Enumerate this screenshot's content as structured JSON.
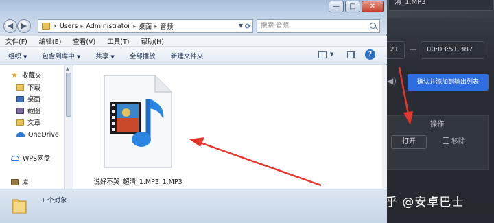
{
  "background_app": {
    "filename": "清_1.MP3",
    "time_start": "21",
    "time_end": "00:03:51.387",
    "confirm_button": "确认并添加到输出列表",
    "operations_header": "操作",
    "open_button": "打开",
    "remove_button": "移除"
  },
  "explorer": {
    "window_controls": {
      "minimize": "—",
      "maximize": "□",
      "close": "✕"
    },
    "breadcrumb": [
      "«",
      "Users",
      "Administrator",
      "桌面",
      "音频"
    ],
    "search_placeholder": "搜索 音频",
    "menu": [
      "文件(F)",
      "编辑(E)",
      "查看(V)",
      "工具(T)",
      "帮助(H)"
    ],
    "toolbar": [
      "组织",
      "包含到库中",
      "共享",
      "全部播放",
      "新建文件夹"
    ],
    "help_label": "?",
    "nav_items": {
      "favorites": "收藏夹",
      "downloads": "下载",
      "desktop": "桌面",
      "screenshots": "截图",
      "articles": "文章",
      "onedrive": "OneDrive",
      "wps": "WPS网盘",
      "library": "库"
    },
    "file_name": "说好不哭_超清_1.MP3_1.MP3",
    "status_text": "1 个对象"
  },
  "watermark": "知乎 @安卓巴士",
  "colors": {
    "accent_blue": "#2f6ee0",
    "annotation_red": "#e8352c",
    "explorer_frame": "#cfd9e6"
  }
}
